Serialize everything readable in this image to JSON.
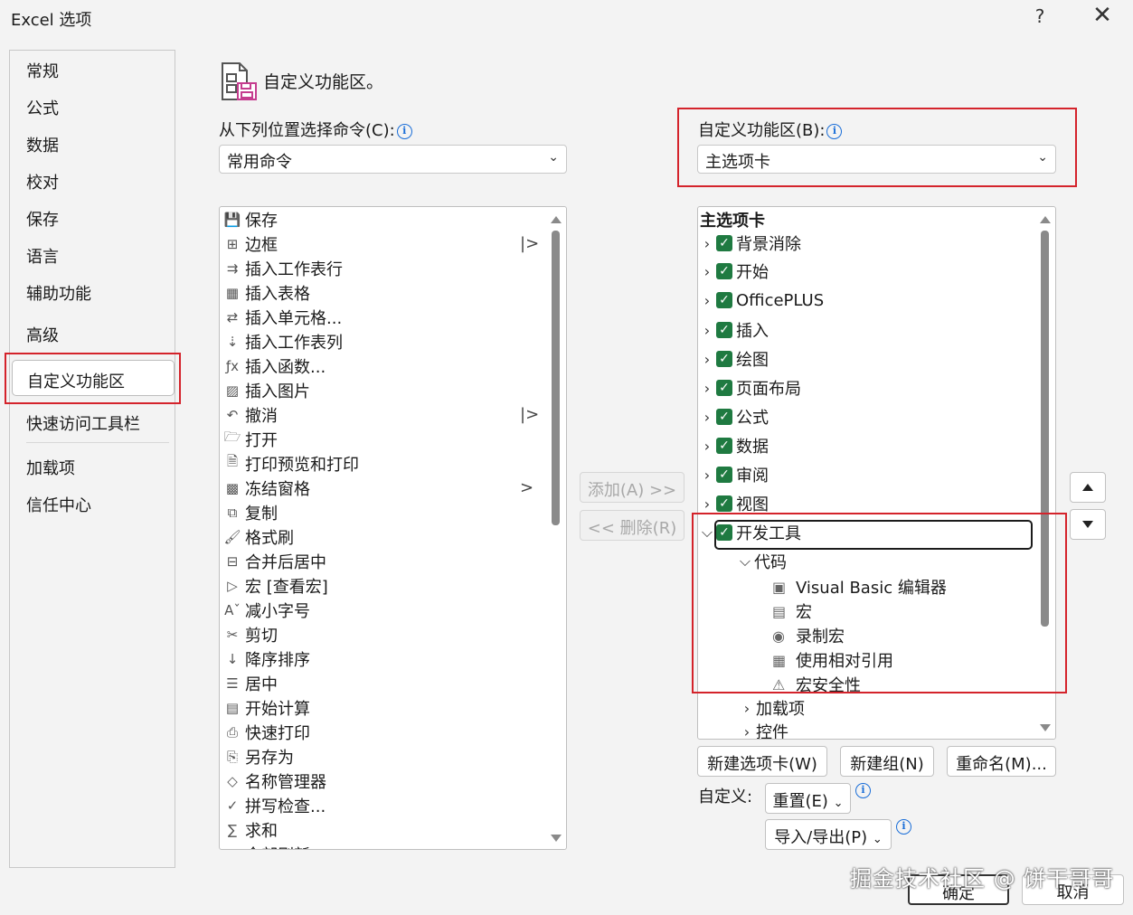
{
  "window": {
    "title": "Excel 选项",
    "help": "?",
    "close": "✕"
  },
  "nav": {
    "items": [
      "常规",
      "公式",
      "数据",
      "校对",
      "保存",
      "语言",
      "辅助功能",
      "高级",
      "自定义功能区",
      "快速访问工具栏",
      "加载项",
      "信任中心"
    ],
    "selected": "自定义功能区"
  },
  "header": {
    "title": "自定义功能区。"
  },
  "left_panel": {
    "label": "从下列位置选择命令(C):",
    "info": "i",
    "dropdown_value": "常用命令",
    "commands": [
      {
        "label": "保存",
        "icon": "save-icon"
      },
      {
        "label": "边框",
        "icon": "border-icon",
        "submenu": "|>"
      },
      {
        "label": "插入工作表行",
        "icon": "insert-row-icon"
      },
      {
        "label": "插入表格",
        "icon": "table-icon"
      },
      {
        "label": "插入单元格...",
        "icon": "insert-cell-icon"
      },
      {
        "label": "插入工作表列",
        "icon": "insert-column-icon"
      },
      {
        "label": "插入函数...",
        "icon": "fx-icon"
      },
      {
        "label": "插入图片",
        "icon": "picture-icon"
      },
      {
        "label": "撤消",
        "icon": "undo-icon",
        "submenu": "|>"
      },
      {
        "label": "打开",
        "icon": "folder-open-icon"
      },
      {
        "label": "打印预览和打印",
        "icon": "print-preview-icon"
      },
      {
        "label": "冻结窗格",
        "icon": "freeze-panes-icon",
        "submenu": ">"
      },
      {
        "label": "复制",
        "icon": "copy-icon"
      },
      {
        "label": "格式刷",
        "icon": "format-painter-icon"
      },
      {
        "label": "合并后居中",
        "icon": "merge-center-icon"
      },
      {
        "label": "宏 [查看宏]",
        "icon": "macro-play-icon"
      },
      {
        "label": "减小字号",
        "icon": "decrease-font-icon"
      },
      {
        "label": "剪切",
        "icon": "scissors-icon"
      },
      {
        "label": "降序排序",
        "icon": "sort-desc-icon"
      },
      {
        "label": "居中",
        "icon": "align-center-icon"
      },
      {
        "label": "开始计算",
        "icon": "calculator-icon"
      },
      {
        "label": "快速打印",
        "icon": "quick-print-icon"
      },
      {
        "label": "另存为",
        "icon": "save-as-icon"
      },
      {
        "label": "名称管理器",
        "icon": "name-manager-icon"
      },
      {
        "label": "拼写检查...",
        "icon": "spell-check-icon"
      },
      {
        "label": "求和",
        "icon": "sum-icon"
      },
      {
        "label": "全部刷新",
        "icon": "refresh-icon"
      }
    ]
  },
  "middle": {
    "add_label": "添加(A) >>",
    "remove_label": "<< 删除(R)"
  },
  "right_panel": {
    "label": "自定义功能区(B):",
    "info": "i",
    "dropdown_value": "主选项卡",
    "tree_header": "主选项卡",
    "tabs": [
      {
        "label": "背景消除",
        "expanded": false
      },
      {
        "label": "开始",
        "expanded": false
      },
      {
        "label": "OfficePLUS",
        "expanded": false
      },
      {
        "label": "插入",
        "expanded": false
      },
      {
        "label": "绘图",
        "expanded": false
      },
      {
        "label": "页面布局",
        "expanded": false
      },
      {
        "label": "公式",
        "expanded": false
      },
      {
        "label": "数据",
        "expanded": false
      },
      {
        "label": "审阅",
        "expanded": false
      },
      {
        "label": "视图",
        "expanded": false
      },
      {
        "label": "开发工具",
        "expanded": true
      }
    ],
    "dev_group": {
      "label": "代码"
    },
    "dev_items": [
      {
        "label": "Visual Basic 编辑器",
        "icon": "vba-editor-icon"
      },
      {
        "label": "宏",
        "icon": "macros-icon"
      },
      {
        "label": "录制宏",
        "icon": "record-macro-icon"
      },
      {
        "label": "使用相对引用",
        "icon": "relative-ref-icon"
      },
      {
        "label": "宏安全性",
        "icon": "warning-icon"
      }
    ],
    "more_groups": [
      "加载项",
      "控件"
    ],
    "buttons": {
      "new_tab": "新建选项卡(W)",
      "new_group": "新建组(N)",
      "rename": "重命名(M)..."
    },
    "customize_label": "自定义:",
    "reset": "重置(E)",
    "import_export": "导入/导出(P)"
  },
  "footer": {
    "ok": "确定",
    "cancel": "取消"
  },
  "watermark": "掘金技术社区 @ 饼干哥哥",
  "colors": {
    "highlight": "#d4232b",
    "check": "#1f7a41",
    "info": "#1a6ed8"
  }
}
